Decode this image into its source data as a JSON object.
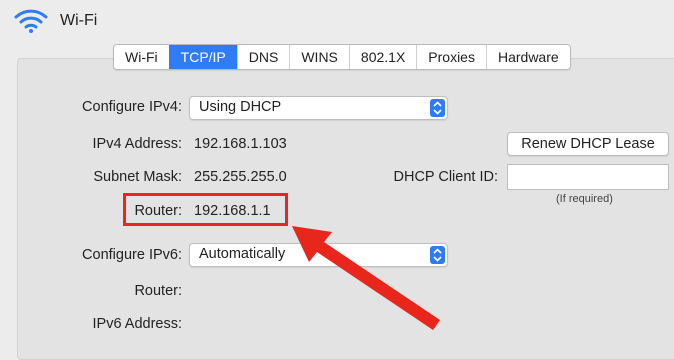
{
  "window": {
    "title": "Wi-Fi",
    "icon": "wifi-icon"
  },
  "tabs": [
    {
      "label": "Wi-Fi",
      "active": false
    },
    {
      "label": "TCP/IP",
      "active": true
    },
    {
      "label": "DNS",
      "active": false
    },
    {
      "label": "WINS",
      "active": false
    },
    {
      "label": "802.1X",
      "active": false
    },
    {
      "label": "Proxies",
      "active": false
    },
    {
      "label": "Hardware",
      "active": false
    }
  ],
  "ipv4": {
    "configure_label": "Configure IPv4:",
    "configure_value": "Using DHCP",
    "address_label": "IPv4 Address:",
    "address_value": "192.168.1.103",
    "subnet_label": "Subnet Mask:",
    "subnet_value": "255.255.255.0",
    "router_label": "Router:",
    "router_value": "192.168.1.1"
  },
  "dhcp": {
    "renew_button": "Renew DHCP Lease",
    "client_id_label": "DHCP Client ID:",
    "client_id_value": "",
    "client_id_hint": "(If required)"
  },
  "ipv6": {
    "configure_label": "Configure IPv6:",
    "configure_value": "Automatically",
    "router_label": "Router:",
    "address_label": "IPv6 Address:"
  },
  "colors": {
    "accent": "#2e7cf6",
    "annotation": "#e8261c",
    "background": "#ececec"
  }
}
